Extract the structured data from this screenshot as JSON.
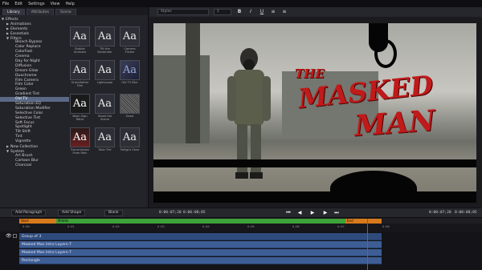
{
  "menu": [
    "File",
    "Edit",
    "Settings",
    "View",
    "Help"
  ],
  "left_tabs": [
    "Library",
    "Attributes",
    "Scene"
  ],
  "tree": [
    {
      "label": "Effects",
      "arrow": "▼",
      "indent": 0
    },
    {
      "label": "Animations",
      "arrow": "▶",
      "indent": 1
    },
    {
      "label": "Elements",
      "arrow": "▶",
      "indent": 1
    },
    {
      "label": "Essentials",
      "arrow": "▶",
      "indent": 1
    },
    {
      "label": "Filters",
      "arrow": "▼",
      "indent": 1
    },
    {
      "label": "Bleach Bypass",
      "arrow": "",
      "indent": 2
    },
    {
      "label": "Color Replace",
      "arrow": "",
      "indent": 2
    },
    {
      "label": "ColorFast",
      "arrow": "",
      "indent": 2
    },
    {
      "label": "Cinema",
      "arrow": "",
      "indent": 2
    },
    {
      "label": "Day for Night",
      "arrow": "",
      "indent": 2
    },
    {
      "label": "Diffusion",
      "arrow": "",
      "indent": 2
    },
    {
      "label": "Dream Glow",
      "arrow": "",
      "indent": 2
    },
    {
      "label": "Duochrome",
      "arrow": "",
      "indent": 2
    },
    {
      "label": "Film Camera",
      "arrow": "",
      "indent": 2
    },
    {
      "label": "Film Color",
      "arrow": "",
      "indent": 2
    },
    {
      "label": "Green",
      "arrow": "",
      "indent": 2
    },
    {
      "label": "Gradient Tint",
      "arrow": "",
      "indent": 2
    },
    {
      "label": "Old TV",
      "arrow": "",
      "indent": 2,
      "selected": true
    },
    {
      "label": "Saturation EQ",
      "arrow": "",
      "indent": 2
    },
    {
      "label": "Saturation Modifier",
      "arrow": "",
      "indent": 2
    },
    {
      "label": "Selective Color",
      "arrow": "",
      "indent": 2
    },
    {
      "label": "Selective Tint",
      "arrow": "",
      "indent": 2
    },
    {
      "label": "Soft Focus",
      "arrow": "",
      "indent": 2
    },
    {
      "label": "Spotlight",
      "arrow": "",
      "indent": 2
    },
    {
      "label": "Tilt Shift",
      "arrow": "",
      "indent": 2
    },
    {
      "label": "Tint",
      "arrow": "",
      "indent": 2
    },
    {
      "label": "Vignette",
      "arrow": "",
      "indent": 2
    },
    {
      "label": "New Collection",
      "arrow": "▶",
      "indent": 1
    },
    {
      "label": "System",
      "arrow": "▼",
      "indent": 1
    },
    {
      "label": "Art Brush",
      "arrow": "",
      "indent": 2
    },
    {
      "label": "Cartoon Blur",
      "arrow": "",
      "indent": 2
    },
    {
      "label": "Charcoal",
      "arrow": "",
      "indent": 2
    }
  ],
  "thumbnails": [
    {
      "glyph": "Aa",
      "caption": "Bubble Animate",
      "style": "plain"
    },
    {
      "glyph": "Aa",
      "caption": "Tilt the Bystander",
      "style": "plain"
    },
    {
      "glyph": "Aa",
      "caption": "Camera Flicker",
      "style": "plain"
    },
    {
      "glyph": "Aa",
      "caption": "Grandfather Film",
      "style": "plain"
    },
    {
      "glyph": "Aa",
      "caption": "Lightscape",
      "style": "plain"
    },
    {
      "glyph": "Aa",
      "caption": "Old TV Blur",
      "style": "blur"
    },
    {
      "glyph": "Aa",
      "caption": "Neon Sign Retro",
      "style": "bw"
    },
    {
      "glyph": "Aa",
      "caption": "Shoot the Scene",
      "style": "plain"
    },
    {
      "glyph": "",
      "caption": "Snow",
      "style": "snow"
    },
    {
      "glyph": "Aa",
      "caption": "Transmission From Rain",
      "style": "red"
    },
    {
      "glyph": "Aa",
      "caption": "Tube Tint",
      "style": "plain"
    },
    {
      "glyph": "Aa",
      "caption": "Twilight Zone",
      "style": "plain"
    }
  ],
  "toolbar": {
    "style_select": "Styles",
    "font_size": "1",
    "bold": "B",
    "italic": "I",
    "underline": "U",
    "align_left": "≡",
    "align_center": "≡"
  },
  "preview": {
    "title_line1": "THE",
    "title_line2": "MASKED",
    "title_line3": "MAN"
  },
  "transport": {
    "add_paragraph": "Add Paragraph",
    "add_shape": "Add Shape",
    "blank": "Blank",
    "current_time_left": "0:00:07;20",
    "duration_left": "0:00:08;05",
    "current_time_right": "0:00:07;20",
    "duration_right": "0:00:08;05"
  },
  "timeline": {
    "in_label": "Start",
    "mid_label": "Middle",
    "out_label": "End",
    "ticks": [
      "0:00",
      "0:01",
      "0:02",
      "0:03",
      "0:04",
      "0:05",
      "0:06",
      "0:07",
      "0:08"
    ],
    "tracks": [
      {
        "label": "Group of 3",
        "group": true
      },
      {
        "label": "Masked Man Intro Layers-7",
        "group": false
      },
      {
        "label": "Masked Man Intro Layers-7",
        "group": false
      },
      {
        "label": "Rectangle",
        "group": false
      }
    ],
    "playhead_fraction": 0.89
  },
  "colors": {
    "title_red": "#c01a1a",
    "track_blue": "#3d5d94",
    "in_marker": "#d77a1c",
    "mid_marker": "#3ea23a",
    "playhead": "#d03a3a"
  }
}
